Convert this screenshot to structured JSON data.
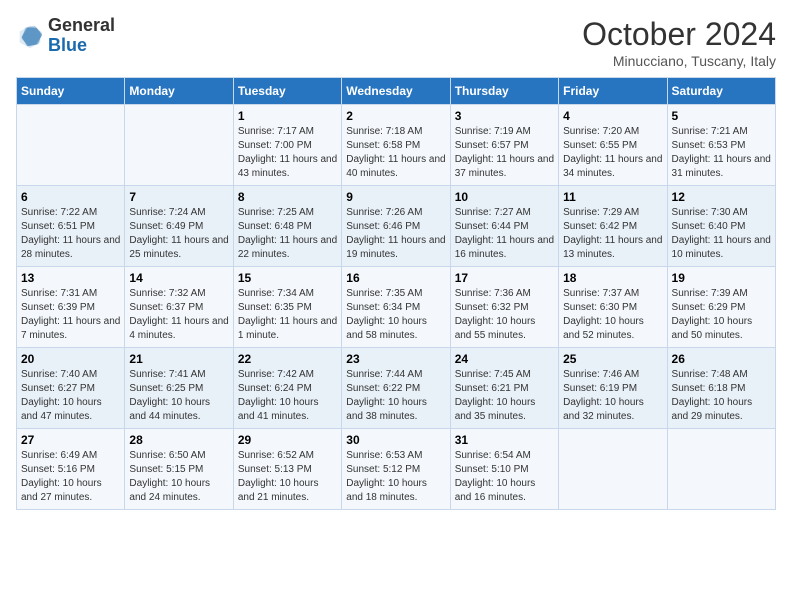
{
  "logo": {
    "general": "General",
    "blue": "Blue"
  },
  "title": "October 2024",
  "location": "Minucciano, Tuscany, Italy",
  "headers": [
    "Sunday",
    "Monday",
    "Tuesday",
    "Wednesday",
    "Thursday",
    "Friday",
    "Saturday"
  ],
  "weeks": [
    [
      {
        "day": "",
        "sunrise": "",
        "sunset": "",
        "daylight": ""
      },
      {
        "day": "",
        "sunrise": "",
        "sunset": "",
        "daylight": ""
      },
      {
        "day": "1",
        "sunrise": "Sunrise: 7:17 AM",
        "sunset": "Sunset: 7:00 PM",
        "daylight": "Daylight: 11 hours and 43 minutes."
      },
      {
        "day": "2",
        "sunrise": "Sunrise: 7:18 AM",
        "sunset": "Sunset: 6:58 PM",
        "daylight": "Daylight: 11 hours and 40 minutes."
      },
      {
        "day": "3",
        "sunrise": "Sunrise: 7:19 AM",
        "sunset": "Sunset: 6:57 PM",
        "daylight": "Daylight: 11 hours and 37 minutes."
      },
      {
        "day": "4",
        "sunrise": "Sunrise: 7:20 AM",
        "sunset": "Sunset: 6:55 PM",
        "daylight": "Daylight: 11 hours and 34 minutes."
      },
      {
        "day": "5",
        "sunrise": "Sunrise: 7:21 AM",
        "sunset": "Sunset: 6:53 PM",
        "daylight": "Daylight: 11 hours and 31 minutes."
      }
    ],
    [
      {
        "day": "6",
        "sunrise": "Sunrise: 7:22 AM",
        "sunset": "Sunset: 6:51 PM",
        "daylight": "Daylight: 11 hours and 28 minutes."
      },
      {
        "day": "7",
        "sunrise": "Sunrise: 7:24 AM",
        "sunset": "Sunset: 6:49 PM",
        "daylight": "Daylight: 11 hours and 25 minutes."
      },
      {
        "day": "8",
        "sunrise": "Sunrise: 7:25 AM",
        "sunset": "Sunset: 6:48 PM",
        "daylight": "Daylight: 11 hours and 22 minutes."
      },
      {
        "day": "9",
        "sunrise": "Sunrise: 7:26 AM",
        "sunset": "Sunset: 6:46 PM",
        "daylight": "Daylight: 11 hours and 19 minutes."
      },
      {
        "day": "10",
        "sunrise": "Sunrise: 7:27 AM",
        "sunset": "Sunset: 6:44 PM",
        "daylight": "Daylight: 11 hours and 16 minutes."
      },
      {
        "day": "11",
        "sunrise": "Sunrise: 7:29 AM",
        "sunset": "Sunset: 6:42 PM",
        "daylight": "Daylight: 11 hours and 13 minutes."
      },
      {
        "day": "12",
        "sunrise": "Sunrise: 7:30 AM",
        "sunset": "Sunset: 6:40 PM",
        "daylight": "Daylight: 11 hours and 10 minutes."
      }
    ],
    [
      {
        "day": "13",
        "sunrise": "Sunrise: 7:31 AM",
        "sunset": "Sunset: 6:39 PM",
        "daylight": "Daylight: 11 hours and 7 minutes."
      },
      {
        "day": "14",
        "sunrise": "Sunrise: 7:32 AM",
        "sunset": "Sunset: 6:37 PM",
        "daylight": "Daylight: 11 hours and 4 minutes."
      },
      {
        "day": "15",
        "sunrise": "Sunrise: 7:34 AM",
        "sunset": "Sunset: 6:35 PM",
        "daylight": "Daylight: 11 hours and 1 minute."
      },
      {
        "day": "16",
        "sunrise": "Sunrise: 7:35 AM",
        "sunset": "Sunset: 6:34 PM",
        "daylight": "Daylight: 10 hours and 58 minutes."
      },
      {
        "day": "17",
        "sunrise": "Sunrise: 7:36 AM",
        "sunset": "Sunset: 6:32 PM",
        "daylight": "Daylight: 10 hours and 55 minutes."
      },
      {
        "day": "18",
        "sunrise": "Sunrise: 7:37 AM",
        "sunset": "Sunset: 6:30 PM",
        "daylight": "Daylight: 10 hours and 52 minutes."
      },
      {
        "day": "19",
        "sunrise": "Sunrise: 7:39 AM",
        "sunset": "Sunset: 6:29 PM",
        "daylight": "Daylight: 10 hours and 50 minutes."
      }
    ],
    [
      {
        "day": "20",
        "sunrise": "Sunrise: 7:40 AM",
        "sunset": "Sunset: 6:27 PM",
        "daylight": "Daylight: 10 hours and 47 minutes."
      },
      {
        "day": "21",
        "sunrise": "Sunrise: 7:41 AM",
        "sunset": "Sunset: 6:25 PM",
        "daylight": "Daylight: 10 hours and 44 minutes."
      },
      {
        "day": "22",
        "sunrise": "Sunrise: 7:42 AM",
        "sunset": "Sunset: 6:24 PM",
        "daylight": "Daylight: 10 hours and 41 minutes."
      },
      {
        "day": "23",
        "sunrise": "Sunrise: 7:44 AM",
        "sunset": "Sunset: 6:22 PM",
        "daylight": "Daylight: 10 hours and 38 minutes."
      },
      {
        "day": "24",
        "sunrise": "Sunrise: 7:45 AM",
        "sunset": "Sunset: 6:21 PM",
        "daylight": "Daylight: 10 hours and 35 minutes."
      },
      {
        "day": "25",
        "sunrise": "Sunrise: 7:46 AM",
        "sunset": "Sunset: 6:19 PM",
        "daylight": "Daylight: 10 hours and 32 minutes."
      },
      {
        "day": "26",
        "sunrise": "Sunrise: 7:48 AM",
        "sunset": "Sunset: 6:18 PM",
        "daylight": "Daylight: 10 hours and 29 minutes."
      }
    ],
    [
      {
        "day": "27",
        "sunrise": "Sunrise: 6:49 AM",
        "sunset": "Sunset: 5:16 PM",
        "daylight": "Daylight: 10 hours and 27 minutes."
      },
      {
        "day": "28",
        "sunrise": "Sunrise: 6:50 AM",
        "sunset": "Sunset: 5:15 PM",
        "daylight": "Daylight: 10 hours and 24 minutes."
      },
      {
        "day": "29",
        "sunrise": "Sunrise: 6:52 AM",
        "sunset": "Sunset: 5:13 PM",
        "daylight": "Daylight: 10 hours and 21 minutes."
      },
      {
        "day": "30",
        "sunrise": "Sunrise: 6:53 AM",
        "sunset": "Sunset: 5:12 PM",
        "daylight": "Daylight: 10 hours and 18 minutes."
      },
      {
        "day": "31",
        "sunrise": "Sunrise: 6:54 AM",
        "sunset": "Sunset: 5:10 PM",
        "daylight": "Daylight: 10 hours and 16 minutes."
      },
      {
        "day": "",
        "sunrise": "",
        "sunset": "",
        "daylight": ""
      },
      {
        "day": "",
        "sunrise": "",
        "sunset": "",
        "daylight": ""
      }
    ]
  ]
}
